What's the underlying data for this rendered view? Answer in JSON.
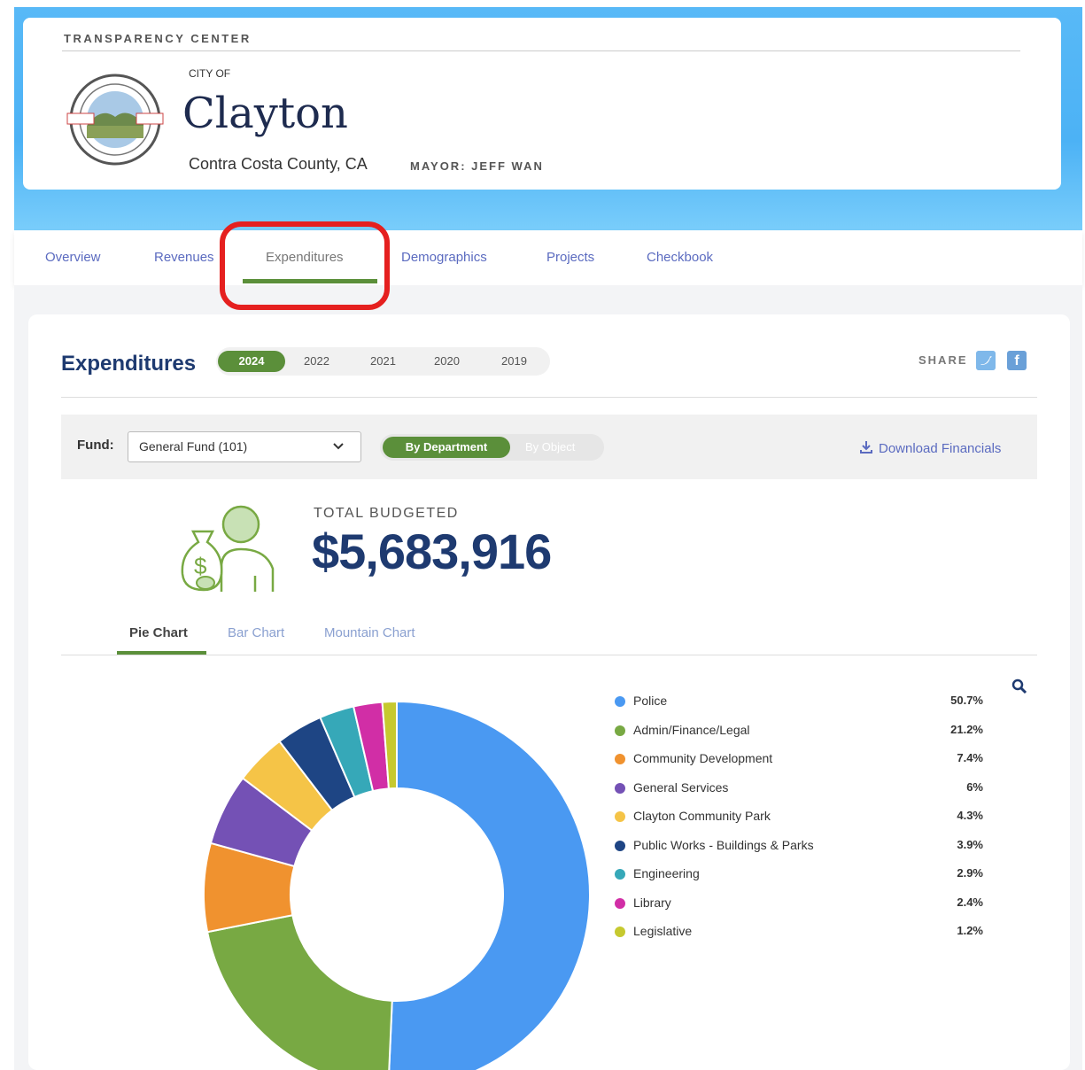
{
  "header": {
    "center_label": "TRANSPARENCY CENTER",
    "city_of": "CITY OF",
    "city_name": "Clayton",
    "county": "Contra Costa County, CA",
    "mayor": "MAYOR: JEFF WAN"
  },
  "nav": {
    "items": [
      "Overview",
      "Revenues",
      "Expenditures",
      "Demographics",
      "Projects",
      "Checkbook"
    ],
    "active": "Expenditures"
  },
  "section": {
    "title": "Expenditures",
    "years": [
      "2024",
      "2022",
      "2021",
      "2020",
      "2019"
    ],
    "active_year": "2024",
    "share_label": "SHARE"
  },
  "filters": {
    "fund_label": "Fund:",
    "fund_value": "General Fund (101)",
    "view_on": "By Department",
    "view_off": "By Object",
    "download_label": "Download Financials"
  },
  "summary": {
    "label": "TOTAL BUDGETED",
    "value": "$5,683,916"
  },
  "chart_tabs": {
    "items": [
      "Pie Chart",
      "Bar Chart",
      "Mountain Chart"
    ],
    "active": "Pie Chart"
  },
  "icons": {
    "download": "download-icon",
    "search": "magnify-icon",
    "chevron": "chevron-down-icon",
    "twitter": "twitter-icon",
    "facebook": "facebook-icon",
    "budget": "money-bag-person-icon"
  },
  "chart_data": {
    "type": "pie",
    "categories": [
      "Police",
      "Admin/Finance/Legal",
      "Community Development",
      "General Services",
      "Clayton Community Park",
      "Public Works - Buildings & Parks",
      "Engineering",
      "Library",
      "Legislative"
    ],
    "values": [
      50.7,
      21.2,
      7.4,
      6,
      4.3,
      3.9,
      2.9,
      2.4,
      1.2
    ],
    "labels": [
      "50.7%",
      "21.2%",
      "7.4%",
      "6%",
      "4.3%",
      "3.9%",
      "2.9%",
      "2.4%",
      "1.2%"
    ],
    "colors": [
      "#4a99f2",
      "#78a943",
      "#f0922f",
      "#7451b5",
      "#f5c447",
      "#1e4584",
      "#36a8b8",
      "#d12ea6",
      "#c6c92f"
    ]
  },
  "colors": {
    "accent_green": "#5b8f3a",
    "navy": "#1e3a70",
    "link_blue": "#5b6bc0",
    "highlight_red": "#e5201f"
  }
}
